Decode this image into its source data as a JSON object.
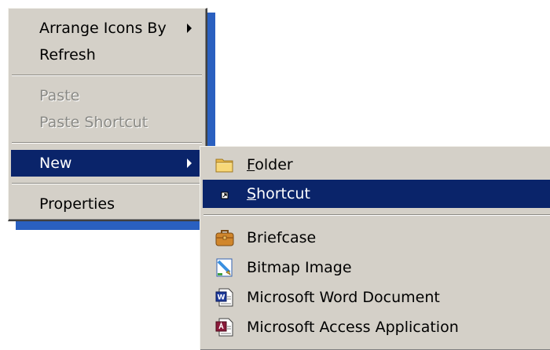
{
  "context_menu": {
    "items": [
      {
        "label": "Arrange Icons By",
        "state": "normal",
        "submenu": true
      },
      {
        "label": "Refresh",
        "state": "normal"
      },
      {
        "label": "Paste",
        "state": "disabled"
      },
      {
        "label": "Paste Shortcut",
        "state": "disabled"
      },
      {
        "label": "New",
        "state": "selected",
        "submenu": true
      },
      {
        "label": "Properties",
        "state": "normal"
      }
    ]
  },
  "new_submenu": {
    "items": [
      {
        "label_access": "F",
        "label_rest": "older",
        "icon": "folder-icon"
      },
      {
        "label_access": "S",
        "label_rest": "hortcut",
        "icon": "shortcut-icon",
        "state": "selected"
      },
      {
        "label": "Briefcase",
        "icon": "briefcase-icon"
      },
      {
        "label": "Bitmap Image",
        "icon": "bitmap-image-icon"
      },
      {
        "label": "Microsoft Word Document",
        "icon": "word-document-icon"
      },
      {
        "label": "Microsoft Access Application",
        "icon": "access-application-icon"
      }
    ]
  },
  "colors": {
    "menu_background": "#d4d0c8",
    "highlight": "#0a246a",
    "desktop_shadow": "#2a60c0"
  }
}
